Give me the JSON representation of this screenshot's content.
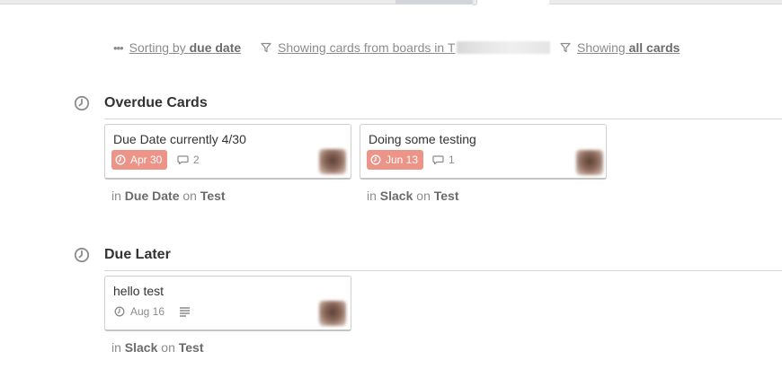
{
  "filters": {
    "sorting": {
      "prefix": "Sorting by ",
      "value": "due date",
      "icon": "more-dots-icon"
    },
    "boards": {
      "text": "Showing cards from boards in T",
      "icon": "filter-icon"
    },
    "cards": {
      "prefix": "Showing ",
      "value": "all cards",
      "icon": "filter-icon"
    }
  },
  "sections": [
    {
      "title": "Overdue Cards",
      "icon": "clock-icon",
      "cards": [
        {
          "title": "Due Date currently 4/30",
          "due": "Apr 30",
          "due_overdue": true,
          "comments": "2",
          "list": "Due Date",
          "board": "Test"
        },
        {
          "title": "Doing some testing",
          "due": "Jun 13",
          "due_overdue": true,
          "comments": "1",
          "list": "Slack",
          "board": "Test"
        }
      ]
    },
    {
      "title": "Due Later",
      "icon": "clock-icon",
      "cards": [
        {
          "title": "hello test",
          "due": "Aug 16",
          "due_overdue": false,
          "has_description": true,
          "list": "Slack",
          "board": "Test"
        }
      ]
    }
  ],
  "labels": {
    "in": "in ",
    "on": " on "
  },
  "colors": {
    "overdue_badge": "#ec9488",
    "muted_text": "#8c8c8c",
    "heading": "#333333"
  }
}
